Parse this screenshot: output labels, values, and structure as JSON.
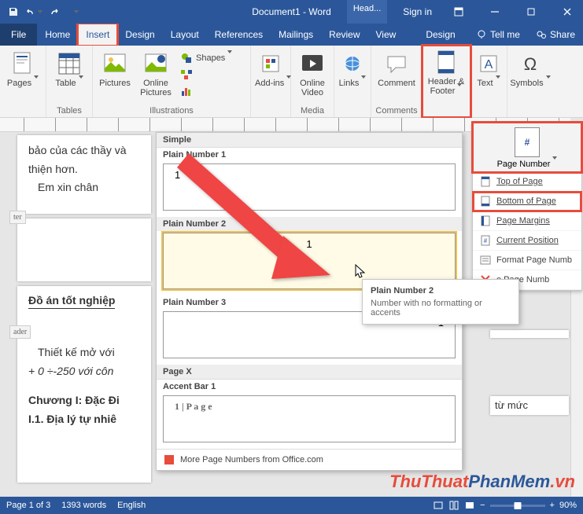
{
  "titlebar": {
    "title": "Document1 - Word",
    "contextTab": "Head...",
    "signin": "Sign in"
  },
  "tabs": {
    "file": "File",
    "home": "Home",
    "insert": "Insert",
    "design": "Design",
    "layout": "Layout",
    "references": "References",
    "mailings": "Mailings",
    "review": "Review",
    "view": "View",
    "designSub": "Design",
    "tellme": "Tell me",
    "share": "Share"
  },
  "ribbon": {
    "pages": {
      "label": "Pages",
      "group": "Pages"
    },
    "table": "Table",
    "tablesGroup": "Tables",
    "pictures": "Pictures",
    "onlinePictures": "Online Pictures",
    "shapes": "Shapes",
    "illustrationsGroup": "Illustrations",
    "addins": "Add-ins",
    "onlineVideo": "Online Video",
    "mediaGroup": "Media",
    "links": "Links",
    "comment": "Comment",
    "commentsGroup": "Comments",
    "headerFooter": "Header & Footer",
    "text": "Text",
    "symbols": "Symbols"
  },
  "document": {
    "line1": "bảo của các thầy và",
    "line2": "thiện hơn.",
    "line3": "Em xin chân",
    "footer_tag": "ter",
    "header_tag": "ader",
    "title": "Đồ án tốt nghiệp",
    "para1": "Thiết kế mở với",
    "para2": "+ 0 ÷-250 với côn",
    "chap": "Chương I: Đặc Đi",
    "sec": "I.1. Địa lý tự nhiê",
    "rfrag1": "từ mức"
  },
  "gallery": {
    "simple": "Simple",
    "pn1": "Plain Number 1",
    "pn2": "Plain Number 2",
    "pn3": "Plain Number 3",
    "pagex": "Page X",
    "accent1": "Accent Bar 1",
    "accent_text": "1 | P a g e",
    "more": "More Page Numbers from Office.com"
  },
  "tooltip": {
    "title": "Plain Number 2",
    "body": "Number with no formatting or accents"
  },
  "pageNumber": {
    "button": "Page Number",
    "topOfPage": "Top of Page",
    "bottomOfPage": "Bottom of Page",
    "pageMargins": "Page Margins",
    "currentPosition": "Current Position",
    "formatPageNumbers": "Format Page Numb",
    "removePageNumbers": "e Page Numb"
  },
  "status": {
    "page": "Page 1 of 3",
    "words": "1393 words",
    "lang": "English",
    "zoom": "90%"
  },
  "watermark": {
    "a": "ThuThuat",
    "b": "PhanMem",
    "c": ".vn"
  }
}
